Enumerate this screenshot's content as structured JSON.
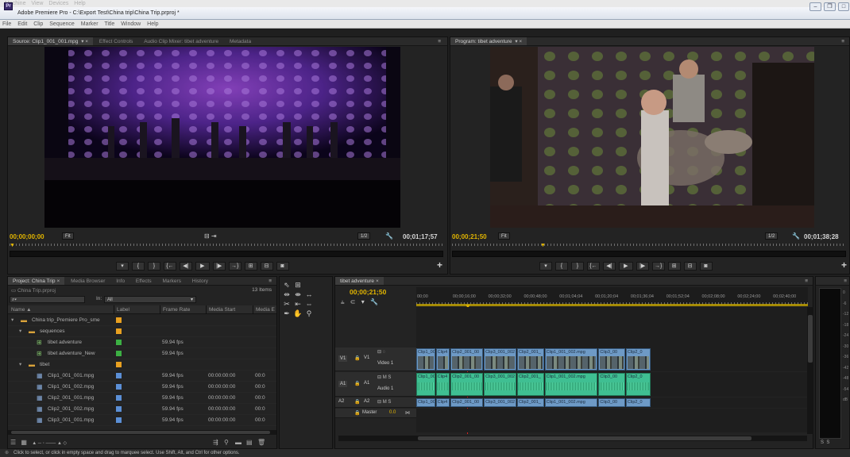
{
  "os_menu": [
    "Machine",
    "View",
    "Devices",
    "Help"
  ],
  "app": {
    "icon": "Pr",
    "title": "Adobe Premiere Pro - C:\\Export Test\\China trip\\China Trip.prproj *"
  },
  "menu": [
    "File",
    "Edit",
    "Clip",
    "Sequence",
    "Marker",
    "Title",
    "Window",
    "Help"
  ],
  "source": {
    "tabs": [
      "Source: Clip1_001_001.mpg",
      "Effect Controls",
      "Audio Clip Mixer: tibet adventure",
      "Metadata"
    ],
    "timecode_in": "00;00;00;00",
    "fit": "Fit",
    "resolution": "1/2",
    "duration": "00;01;17;57"
  },
  "program": {
    "tab": "Program: tibet adventure",
    "timecode_in": "00;00;21;50",
    "fit": "Fit",
    "resolution": "1/2",
    "duration": "00;01;38;28"
  },
  "project": {
    "tabs": [
      "Project: China Trip",
      "Media Browser",
      "Info",
      "Effects",
      "Markers",
      "History"
    ],
    "file": "China Trip.prproj",
    "count": "13 Items",
    "in_label": "In:",
    "in_value": "All",
    "columns": [
      "Name",
      "Label",
      "Frame Rate",
      "Media Start",
      "Media E"
    ],
    "rows": [
      {
        "indent": 0,
        "icon": "folder-icon",
        "name": "China trip_Premiere Pro_sme",
        "color": "#e8a020",
        "rate": "",
        "start": "",
        "end": ""
      },
      {
        "indent": 1,
        "icon": "folder-icon",
        "name": "sequences",
        "color": "#e8a020",
        "rate": "",
        "start": "",
        "end": ""
      },
      {
        "indent": 2,
        "icon": "sequence-icon",
        "name": "tibet adventure",
        "color": "#3cb043",
        "rate": "59.94 fps",
        "start": "",
        "end": ""
      },
      {
        "indent": 2,
        "icon": "sequence-icon",
        "name": "tibet adventure_New",
        "color": "#3cb043",
        "rate": "59.94 fps",
        "start": "",
        "end": ""
      },
      {
        "indent": 1,
        "icon": "folder-icon",
        "name": "tibet",
        "color": "#e8a020",
        "rate": "",
        "start": "",
        "end": ""
      },
      {
        "indent": 2,
        "icon": "clip-icon",
        "name": "Clip1_001_001.mpg",
        "color": "#5b8fd6",
        "rate": "59.94 fps",
        "start": "00:00:00:00",
        "end": "00:0"
      },
      {
        "indent": 2,
        "icon": "clip-icon",
        "name": "Clip1_001_002.mpg",
        "color": "#5b8fd6",
        "rate": "59.94 fps",
        "start": "00:00:00:00",
        "end": "00:0"
      },
      {
        "indent": 2,
        "icon": "clip-icon",
        "name": "Clip2_001_001.mpg",
        "color": "#5b8fd6",
        "rate": "59.94 fps",
        "start": "00:00:00:00",
        "end": "00:0"
      },
      {
        "indent": 2,
        "icon": "clip-icon",
        "name": "Clip2_001_002.mpg",
        "color": "#5b8fd6",
        "rate": "59.94 fps",
        "start": "00:00:00:00",
        "end": "00:0"
      },
      {
        "indent": 2,
        "icon": "clip-icon",
        "name": "Clip3_001_001.mpg",
        "color": "#5b8fd6",
        "rate": "59.94 fps",
        "start": "00:00:00:00",
        "end": "00:0"
      }
    ]
  },
  "timeline": {
    "tab": "tibet adventure",
    "timecode": "00;00;21;50",
    "ruler": [
      "00;00",
      "00;00;16;00",
      "00;00;32;00",
      "00;00;48;00",
      "00;01;04;04",
      "00;01;20;04",
      "00;01;36;04",
      "00;01;52;04",
      "00;02;08;00",
      "00;02;24;00",
      "00;02;40;00"
    ],
    "tracks": {
      "v1_label": "V1",
      "v1_name": "Video 1",
      "a1_label": "A1",
      "a1_name": "Audio 1",
      "a2_label": "A2",
      "master": "Master",
      "master_value": "0.0"
    },
    "clips": [
      "Clip1_0C",
      "Clip4",
      "Clip2_001_00",
      "Clip3_001_002",
      "Clip2_001_",
      "Clip1_001_002.mpg",
      "Clip3_00",
      "Clip2_0"
    ]
  },
  "status": "Click to select, or click in empty space and drag to marquee select. Use Shift, Alt, and Ctrl for other options."
}
